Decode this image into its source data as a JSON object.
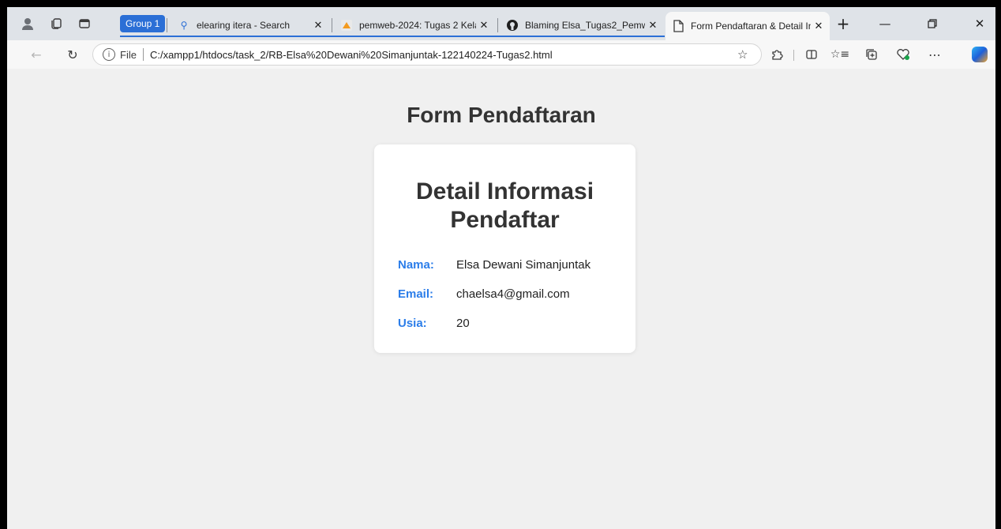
{
  "browser": {
    "tab_group": "Group 1",
    "tabs": [
      {
        "title": "elearing itera - Search",
        "icon": "search-icon"
      },
      {
        "title": "pemweb-2024: Tugas 2 Kelas",
        "icon": "moodle-icon"
      },
      {
        "title": "Blaming Elsa_Tugas2_Pemwe",
        "icon": "github-icon"
      },
      {
        "title": "Form Pendaftaran & Detail In",
        "icon": "page-icon",
        "active": true
      }
    ],
    "address": {
      "scheme_label": "File",
      "url": "C:/xampp1/htdocs/task_2/RB-Elsa%20Dewani%20Simanjuntak-122140224-Tugas2.html"
    },
    "accent_color": "#2b6fd6"
  },
  "page": {
    "title": "Form Pendaftaran",
    "card": {
      "title": "Detail Informasi Pendaftar",
      "fields": [
        {
          "label": "Nama:",
          "value": "Elsa Dewani Simanjuntak"
        },
        {
          "label": "Email:",
          "value": "chaelsa4@gmail.com"
        },
        {
          "label": "Usia:",
          "value": "20"
        }
      ]
    },
    "label_color": "#2b7de9",
    "background_color": "#f0f0f0"
  }
}
